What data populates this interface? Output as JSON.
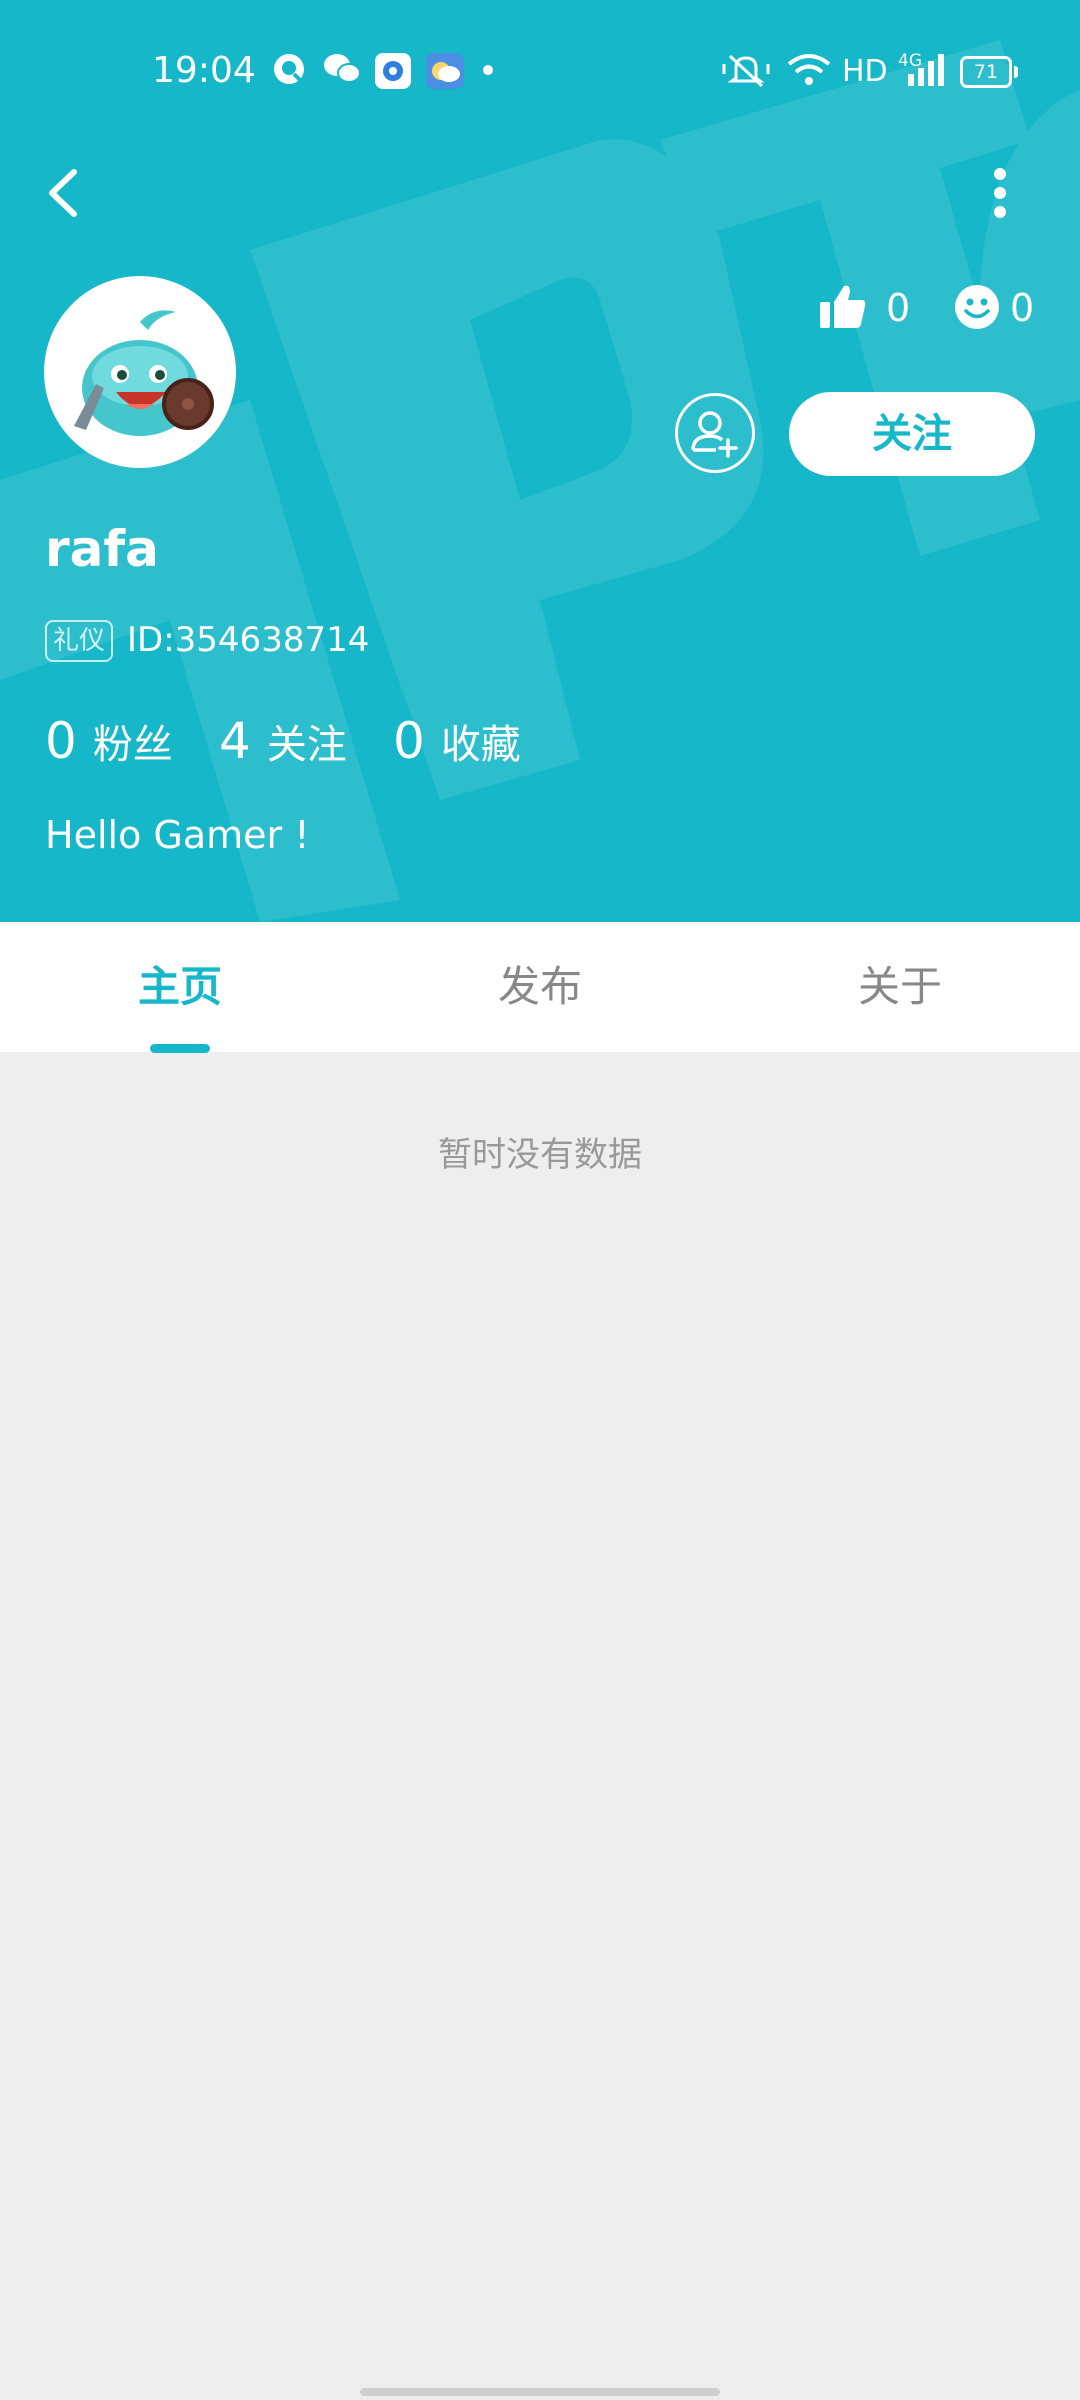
{
  "status_bar": {
    "time": "19:04",
    "network_label": "HD",
    "signal_label": "4G",
    "battery": "71",
    "icons": [
      "qq-icon",
      "wechat-icon",
      "browser-icon",
      "weather-icon",
      "notification-dot-icon",
      "mute-icon",
      "wifi-icon",
      "signal-icon",
      "battery-icon"
    ]
  },
  "nav": {
    "back_icon": "back-arrow-icon",
    "more_icon": "more-vertical-icon"
  },
  "profile": {
    "username": "rafa",
    "badge": "礼仪",
    "id_text": "ID:354638714",
    "likes": "0",
    "smiles": "0",
    "follow_button": "关注",
    "add_friend_icon": "add-user-icon",
    "stats": [
      {
        "value": "0",
        "label": "粉丝"
      },
      {
        "value": "4",
        "label": "关注"
      },
      {
        "value": "0",
        "label": "收藏"
      }
    ],
    "bio": "Hello Gamer !"
  },
  "tabs": [
    {
      "label": "主页",
      "active": true
    },
    {
      "label": "发布",
      "active": false
    },
    {
      "label": "关于",
      "active": false
    }
  ],
  "content": {
    "empty_message": "暂时没有数据"
  },
  "colors": {
    "accent": "#15b7c8",
    "background": "#eeeeee",
    "tab_inactive": "#888888"
  }
}
